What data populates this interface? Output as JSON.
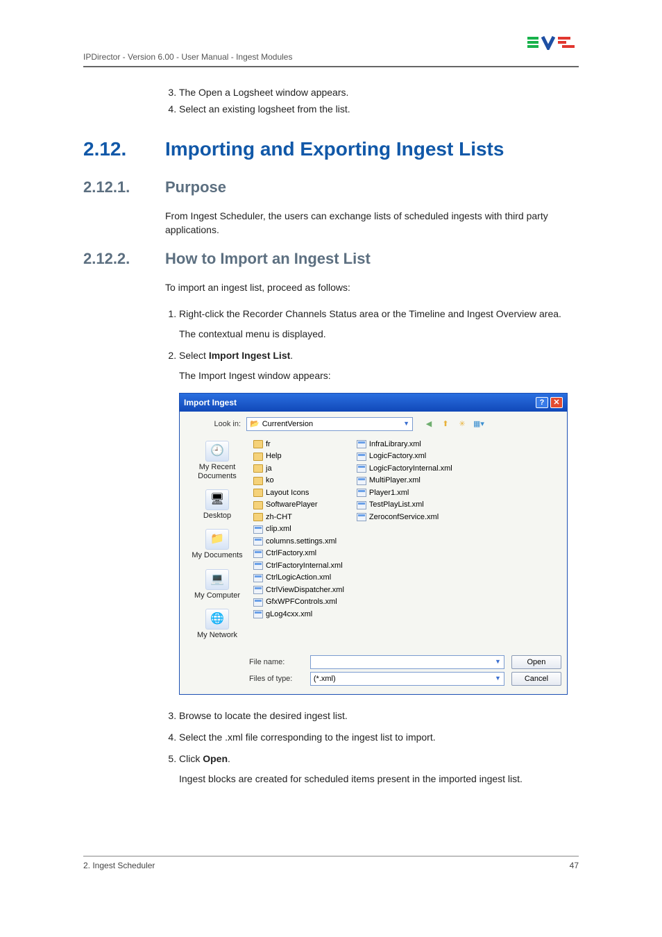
{
  "header": {
    "text": "IPDirector - Version 6.00 - User Manual - Ingest Modules"
  },
  "pre_steps": [
    "The Open a Logsheet window appears.",
    "Select an existing logsheet from the list."
  ],
  "section": {
    "num": "2.12.",
    "title": "Importing and Exporting Ingest Lists"
  },
  "sub1": {
    "num": "2.12.1.",
    "title": "Purpose",
    "body": "From Ingest Scheduler, the users can exchange lists of scheduled ingests with third party applications."
  },
  "sub2": {
    "num": "2.12.2.",
    "title": "How to Import an Ingest List",
    "intro": "To import an ingest list, proceed as follows:",
    "step1": "Right-click the Recorder Channels Status area or the Timeline and Ingest Overview area.",
    "step1_after": "The contextual menu is displayed.",
    "step2_pre": "Select ",
    "step2_bold": "Import Ingest List",
    "step2_post": ".",
    "step2_after": "The Import Ingest window appears:",
    "step3": "Browse to locate the desired ingest list.",
    "step4": "Select the .xml file corresponding to the ingest list to import.",
    "step5_pre": "Click ",
    "step5_bold": "Open",
    "step5_post": ".",
    "step5_after": "Ingest blocks are created for scheduled items present in the imported ingest list."
  },
  "dialog": {
    "title": "Import Ingest",
    "lookin_label": "Look in:",
    "lookin_value": "CurrentVersion",
    "places": {
      "recent": "My Recent Documents",
      "desktop": "Desktop",
      "mydocs": "My Documents",
      "mycomp": "My Computer",
      "mynet": "My Network"
    },
    "col1": [
      {
        "t": "folder",
        "n": "fr"
      },
      {
        "t": "folder",
        "n": "Help"
      },
      {
        "t": "folder",
        "n": "ja"
      },
      {
        "t": "folder",
        "n": "ko"
      },
      {
        "t": "folder",
        "n": "Layout Icons"
      },
      {
        "t": "folder",
        "n": "SoftwarePlayer"
      },
      {
        "t": "folder",
        "n": "zh-CHT"
      },
      {
        "t": "xml",
        "n": "clip.xml"
      },
      {
        "t": "xml",
        "n": "columns.settings.xml"
      },
      {
        "t": "xml",
        "n": "CtrlFactory.xml"
      },
      {
        "t": "xml",
        "n": "CtrlFactoryInternal.xml"
      },
      {
        "t": "xml",
        "n": "CtrlLogicAction.xml"
      },
      {
        "t": "xml",
        "n": "CtrlViewDispatcher.xml"
      },
      {
        "t": "xml",
        "n": "GfxWPFControls.xml"
      },
      {
        "t": "xml",
        "n": "gLog4cxx.xml"
      }
    ],
    "col2": [
      {
        "t": "xml",
        "n": "InfraLibrary.xml"
      },
      {
        "t": "xml",
        "n": "LogicFactory.xml"
      },
      {
        "t": "xml",
        "n": "LogicFactoryInternal.xml"
      },
      {
        "t": "xml",
        "n": "MultiPlayer.xml"
      },
      {
        "t": "xml",
        "n": "Player1.xml"
      },
      {
        "t": "xml",
        "n": "TestPlayList.xml"
      },
      {
        "t": "xml",
        "n": "ZeroconfService.xml"
      }
    ],
    "filename_label": "File name:",
    "filename_value": "",
    "filetype_label": "Files of type:",
    "filetype_value": "(*.xml)",
    "open_btn": "Open",
    "cancel_btn": "Cancel"
  },
  "footer": {
    "left": "2. Ingest Scheduler",
    "right": "47"
  }
}
